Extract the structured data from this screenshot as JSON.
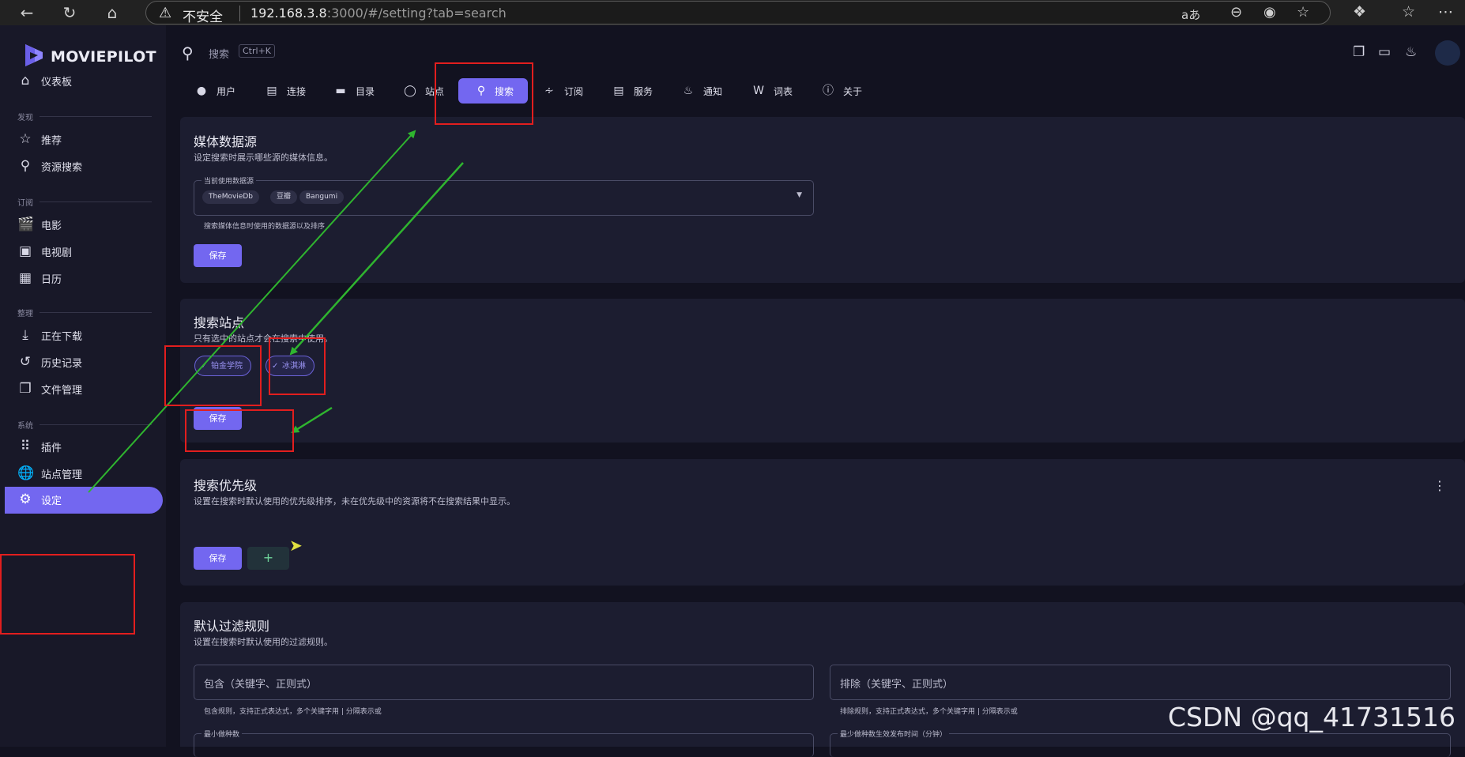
{
  "browser": {
    "insecure_label": "不安全",
    "url_host": "192.168.3.8",
    "url_rest": ":3000/#/setting?tab=search",
    "icons": [
      "back-arrow-icon",
      "refresh-icon",
      "home-icon",
      "warning-icon",
      "read-aloud-icon",
      "zoom-out-icon",
      "edge-icon",
      "favorite-star-icon",
      "extensions-icon",
      "favorites-icon",
      "more-icon"
    ]
  },
  "sidebar": {
    "brand": "MOVIEPILOT",
    "dashboard": "仪表板",
    "sections": {
      "discover": "发现",
      "subscribe": "订阅",
      "organize": "整理",
      "system": "系统"
    },
    "items": {
      "recommend": "推荐",
      "resource_search": "资源搜索",
      "movies": "电影",
      "tv": "电视剧",
      "calendar": "日历",
      "downloading": "正在下载",
      "history": "历史记录",
      "file_manager": "文件管理",
      "plugins": "插件",
      "site_manager": "站点管理",
      "settings": "设定"
    }
  },
  "topbar": {
    "search_placeholder": "搜索",
    "search_shortcut": "Ctrl+K"
  },
  "tabs": {
    "user": "用户",
    "connection": "连接",
    "directory": "目录",
    "sites": "站点",
    "search": "搜索",
    "subscribe": "订阅",
    "service": "服务",
    "notify": "通知",
    "words": "词表",
    "about": "关于"
  },
  "media_source": {
    "title": "媒体数据源",
    "subtitle": "设定搜索时展示哪些源的媒体信息。",
    "field_label": "当前使用数据源",
    "chips": [
      "TheMovieDb",
      "豆瓣",
      "Bangumi"
    ],
    "hint": "搜索媒体信息时使用的数据源以及排序",
    "save": "保存"
  },
  "search_sites": {
    "title": "搜索站点",
    "subtitle": "只有选中的站点才会在搜索中使用。",
    "sites": [
      "铂金学院",
      "冰淇淋"
    ],
    "save": "保存"
  },
  "search_priority": {
    "title": "搜索优先级",
    "subtitle": "设置在搜索时默认使用的优先级排序，未在优先级中的资源将不在搜索结果中显示。",
    "save": "保存",
    "add": "+"
  },
  "filter_rules": {
    "title": "默认过滤规则",
    "subtitle": "设置在搜索时默认使用的过滤规则。",
    "include_placeholder": "包含（关键字、正则式）",
    "include_hint": "包含规则，支持正式表达式，多个关键字用 | 分隔表示或",
    "exclude_placeholder": "排除（关键字、正则式）",
    "exclude_hint": "排除规则，支持正式表达式，多个关键字用 | 分隔表示或",
    "min_seeders_label": "最小做种数",
    "min_seeders_time_label": "最少做种数生效发布时间（分钟）"
  },
  "watermark": "CSDN @qq_41731516",
  "colors": {
    "accent": "#7367f0",
    "annotation_red": "#e21e1e",
    "annotation_green": "#2fb52f"
  }
}
